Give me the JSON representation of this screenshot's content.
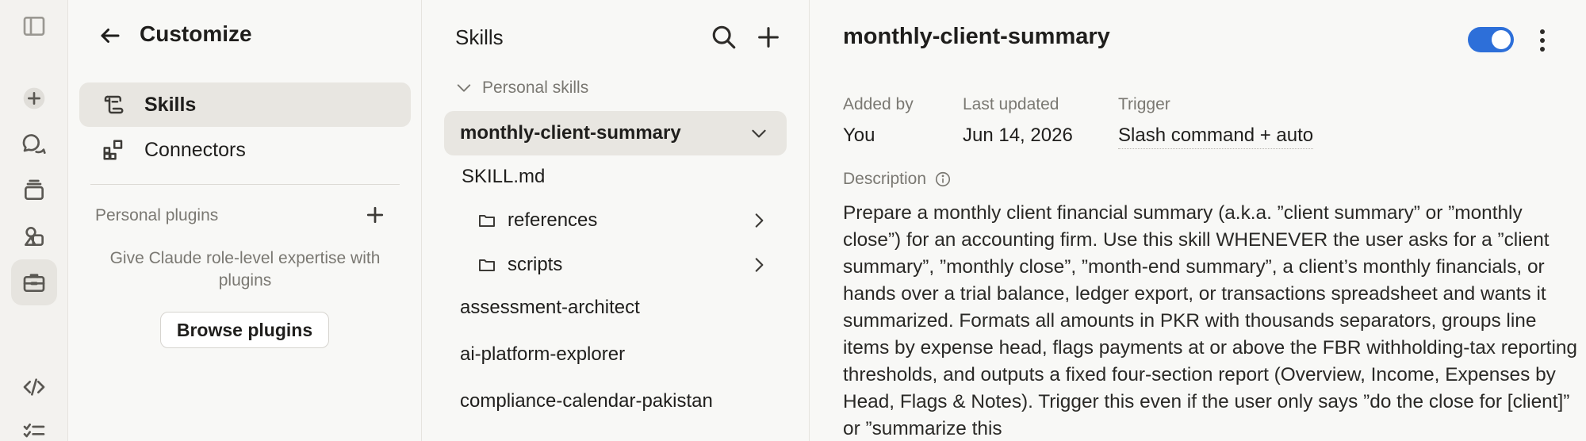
{
  "rail": {
    "icons": [
      "sidebar-toggle-icon",
      "new-chat-icon",
      "chats-icon",
      "projects-icon",
      "artifacts-icon",
      "customize-icon",
      "code-icon",
      "tasks-icon"
    ]
  },
  "customize": {
    "title": "Customize",
    "nav": [
      {
        "label": "Skills",
        "icon": "skills-icon",
        "active": true
      },
      {
        "label": "Connectors",
        "icon": "connectors-icon",
        "active": false
      }
    ],
    "plugins_label": "Personal plugins",
    "plugins_empty": "Give Claude role-level expertise with plugins",
    "browse_label": "Browse plugins"
  },
  "skills": {
    "header": "Skills",
    "group_label": "Personal skills",
    "selected": "monthly-client-summary",
    "files": [
      {
        "label": "SKILL.md",
        "type": "file"
      },
      {
        "label": "references",
        "type": "folder"
      },
      {
        "label": "scripts",
        "type": "folder"
      }
    ],
    "others": [
      "assessment-architect",
      "ai-platform-explorer",
      "compliance-calendar-pakistan"
    ]
  },
  "detail": {
    "name": "monthly-client-summary",
    "enabled": true,
    "added_by_label": "Added by",
    "added_by": "You",
    "updated_label": "Last updated",
    "updated": "Jun 14, 2026",
    "trigger_label": "Trigger",
    "trigger": "Slash command + auto",
    "description_label": "Description",
    "description": "Prepare a monthly client financial summary (a.k.a. ”client summary” or ”monthly close”) for an accounting firm. Use this skill WHENEVER the user asks for a ”client summary”, ”monthly close”, ”month-end summary”, a client’s monthly financials, or hands over a trial balance, ledger export, or transactions spreadsheet and wants it summarized. Formats all amounts in PKR with thousands separators, groups line items by expense head, flags payments at or above the FBR withholding-tax reporting thresholds, and outputs a fixed four-section report (Overview, Income, Expenses by Head, Flags & Notes). Trigger this even if the user only says ”do the close for [client]” or ”summarize this"
  }
}
